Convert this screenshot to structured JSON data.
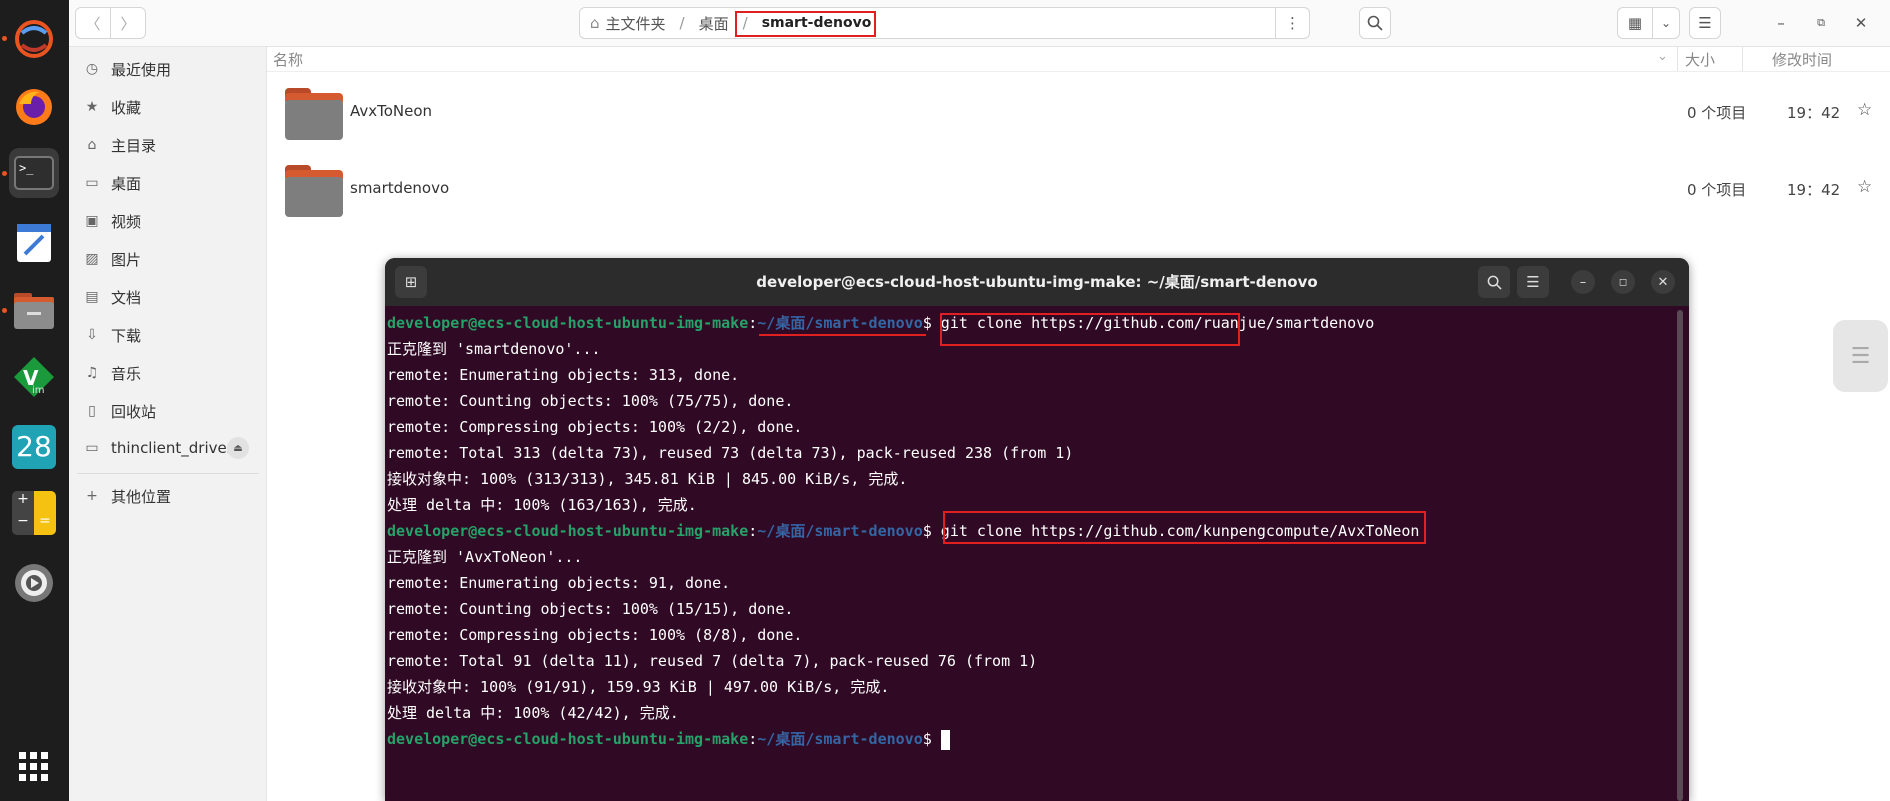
{
  "dock": {
    "items": [
      {
        "name": "ubuntu-logo-icon"
      },
      {
        "name": "firefox-icon"
      },
      {
        "name": "terminal-icon"
      },
      {
        "name": "text-editor-icon"
      },
      {
        "name": "files-icon"
      },
      {
        "name": "vim-icon"
      },
      {
        "name": "calendar-icon",
        "label": "28"
      },
      {
        "name": "calculator-icon"
      },
      {
        "name": "settings-icon"
      },
      {
        "name": "app-grid-icon"
      }
    ]
  },
  "files": {
    "path": {
      "home": "主文件夹",
      "desktop": "桌面",
      "current": "smart-denovo",
      "separator": "/"
    },
    "sidebar": [
      {
        "icon": "clock-icon",
        "glyph": "◷",
        "label": "最近使用"
      },
      {
        "icon": "star-icon",
        "glyph": "★",
        "label": "收藏"
      },
      {
        "icon": "home-icon",
        "glyph": "⌂",
        "label": "主目录"
      },
      {
        "icon": "desktop-icon",
        "glyph": "▭",
        "label": "桌面"
      },
      {
        "icon": "video-icon",
        "glyph": "▣",
        "label": "视频"
      },
      {
        "icon": "picture-icon",
        "glyph": "▨",
        "label": "图片"
      },
      {
        "icon": "document-icon",
        "glyph": "▤",
        "label": "文档"
      },
      {
        "icon": "download-icon",
        "glyph": "⇩",
        "label": "下载"
      },
      {
        "icon": "music-icon",
        "glyph": "♫",
        "label": "音乐"
      },
      {
        "icon": "trash-icon",
        "glyph": "▯",
        "label": "回收站"
      },
      {
        "icon": "drive-icon",
        "glyph": "▭",
        "label": "thinclient_drives"
      },
      {
        "icon": "plus-icon",
        "glyph": "+",
        "label": "其他位置"
      }
    ],
    "columns": {
      "name": "名称",
      "size": "大小",
      "modified": "修改时间"
    },
    "rows": [
      {
        "name": "AvxToNeon",
        "size": "0 个项目",
        "modified": "19：42"
      },
      {
        "name": "smartdenovo",
        "size": "0 个项目",
        "modified": "19：42"
      }
    ]
  },
  "terminal": {
    "title": "developer@ecs-cloud-host-ubuntu-img-make: ~/桌面/smart-denovo",
    "prompt_user": "developer@ecs-cloud-host-ubuntu-img-make",
    "prompt_sep": ":",
    "prompt_path": "~/桌面/smart-denovo",
    "prompt_dollar": "$",
    "commands": [
      "git clone https://github.com/ruanjue/smartdenovo",
      "git clone https://github.com/kunpengcompute/AvxToNeon"
    ],
    "output1": [
      "正克隆到 'smartdenovo'...",
      "remote: Enumerating objects: 313, done.",
      "remote: Counting objects: 100% (75/75), done.",
      "remote: Compressing objects: 100% (2/2), done.",
      "remote: Total 313 (delta 73), reused 73 (delta 73), pack-reused 238 (from 1)",
      "接收对象中: 100% (313/313), 345.81 KiB | 845.00 KiB/s, 完成.",
      "处理 delta 中: 100% (163/163), 完成."
    ],
    "output2": [
      "正克隆到 'AvxToNeon'...",
      "remote: Enumerating objects: 91, done.",
      "remote: Counting objects: 100% (15/15), done.",
      "remote: Compressing objects: 100% (8/8), done.",
      "remote: Total 91 (delta 11), reused 7 (delta 7), pack-reused 76 (from 1)",
      "接收对象中: 100% (91/91), 159.93 KiB | 497.00 KiB/s, 完成.",
      "处理 delta 中: 100% (42/42), 完成."
    ]
  }
}
